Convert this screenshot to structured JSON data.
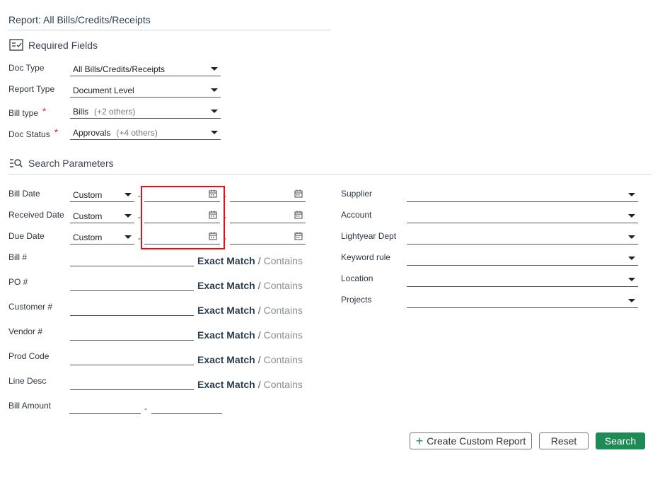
{
  "report_title": "Report: All Bills/Credits/Receipts",
  "required": {
    "heading": "Required Fields",
    "doc_type": {
      "label": "Doc Type",
      "value": "All Bills/Credits/Receipts"
    },
    "report_type": {
      "label": "Report Type",
      "value": "Document Level"
    },
    "bill_type": {
      "label": "Bill type",
      "value": "Bills",
      "extra": "(+2 others)",
      "required_mark": "*"
    },
    "doc_status": {
      "label": "Doc Status",
      "value": "Approvals",
      "extra": "(+4 others)",
      "required_mark": "*"
    }
  },
  "search": {
    "heading": "Search Parameters",
    "dates": [
      {
        "label": "Bill Date",
        "mode": "Custom"
      },
      {
        "label": "Received Date",
        "mode": "Custom"
      },
      {
        "label": "Due Date",
        "mode": "Custom"
      }
    ],
    "text_fields": [
      {
        "label": "Bill #"
      },
      {
        "label": "PO #"
      },
      {
        "label": "Customer #"
      },
      {
        "label": "Vendor #"
      },
      {
        "label": "Prod Code"
      },
      {
        "label": "Line Desc"
      }
    ],
    "exact_match": "Exact Match",
    "separator": "/",
    "contains": "Contains",
    "bill_amount": {
      "label": "Bill Amount",
      "dash": "-"
    },
    "range_dash": "-",
    "right_fields": [
      {
        "label": "Supplier"
      },
      {
        "label": "Account"
      },
      {
        "label": "Lightyear Dept"
      },
      {
        "label": "Keyword rule"
      },
      {
        "label": "Location"
      },
      {
        "label": "Projects"
      }
    ]
  },
  "buttons": {
    "create_custom_report": "Create Custom Report",
    "reset": "Reset",
    "search": "Search"
  },
  "colors": {
    "accent": "#1e8a55",
    "required": "#d0312d",
    "highlight": "#e3101a"
  }
}
